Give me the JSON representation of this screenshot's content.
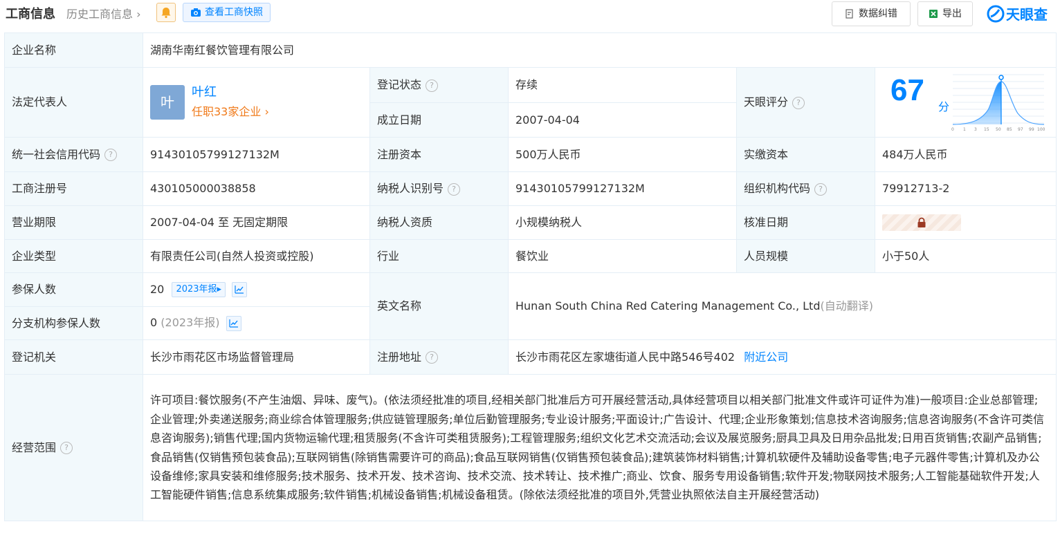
{
  "header": {
    "title": "工商信息",
    "history": "历史工商信息",
    "snapshot": "查看工商快照",
    "correct": "数据纠错",
    "export": "导出",
    "brand": "天眼查"
  },
  "company": {
    "name_label": "企业名称",
    "name": "湖南华南红餐饮管理有限公司",
    "legal_label": "法定代表人",
    "legal_avatar": "叶",
    "legal_name": "叶红",
    "legal_posts": "任职33家企业",
    "status_label": "登记状态",
    "status": "存续",
    "founded_label": "成立日期",
    "founded": "2007-04-04",
    "score_label": "天眼评分",
    "score": "67",
    "score_unit": "分",
    "score_ticks": [
      "0",
      "1",
      "3",
      "15",
      "50",
      "85",
      "97",
      "99",
      "100"
    ],
    "credit_label": "统一社会信用代码",
    "credit_code": "91430105799127132M",
    "capital_label": "注册资本",
    "capital": "500万人民币",
    "paid_label": "实缴资本",
    "paid": "484万人民币",
    "reg_no_label": "工商注册号",
    "reg_no": "430105000038858",
    "tax_id_label": "纳税人识别号",
    "tax_id": "91430105799127132M",
    "org_code_label": "组织机构代码",
    "org_code": "79912713-2",
    "term_label": "营业期限",
    "term": "2007-04-04 至 无固定期限",
    "tax_qual_label": "纳税人资质",
    "tax_qual": "小规模纳税人",
    "approve_label": "核准日期",
    "type_label": "企业类型",
    "type": "有限责任公司(自然人投资或控股)",
    "industry_label": "行业",
    "industry": "餐饮业",
    "staff_label": "人员规模",
    "staff": "小于50人",
    "insured_label": "参保人数",
    "insured": "20",
    "insured_report": "2023年报",
    "en_name_label": "英文名称",
    "en_name": "Hunan South China Red Catering Management Co., Ltd",
    "en_auto": "(自动翻译)",
    "branch_label": "分支机构参保人数",
    "branch_insured": "0",
    "branch_report": "(2023年报)",
    "authority_label": "登记机关",
    "authority": "长沙市雨花区市场监督管理局",
    "address_label": "注册地址",
    "address": "长沙市雨花区左家塘街道人民中路546号402",
    "nearby": "附近公司",
    "scope_label": "经营范围",
    "scope": "许可项目:餐饮服务(不产生油烟、异味、废气)。(依法须经批准的项目,经相关部门批准后方可开展经营活动,具体经营项目以相关部门批准文件或许可证件为准)一般项目:企业总部管理;企业管理;外卖递送服务;商业综合体管理服务;供应链管理服务;单位后勤管理服务;专业设计服务;平面设计;广告设计、代理;企业形象策划;信息技术咨询服务;信息咨询服务(不含许可类信息咨询服务);销售代理;国内货物运输代理;租赁服务(不含许可类租赁服务);工程管理服务;组织文化艺术交流活动;会议及展览服务;厨具卫具及日用杂品批发;日用百货销售;农副产品销售;食品销售(仅销售预包装食品);互联网销售(除销售需要许可的商品);食品互联网销售(仅销售预包装食品);建筑装饰材料销售;计算机软硬件及辅助设备零售;电子元器件零售;计算机及办公设备维修;家具安装和维修服务;技术服务、技术开发、技术咨询、技术交流、技术转让、技术推广;商业、饮食、服务专用设备销售;软件开发;物联网技术服务;人工智能基础软件开发;人工智能硬件销售;信息系统集成服务;软件销售;机械设备销售;机械设备租赁。(除依法须经批准的项目外,凭营业执照依法自主开展经营活动)"
  },
  "colors": {
    "accent": "#0084ff",
    "status_green": "#1d9a4a",
    "orange": "#f07a1a",
    "label_bg": "#f2f9fc"
  }
}
